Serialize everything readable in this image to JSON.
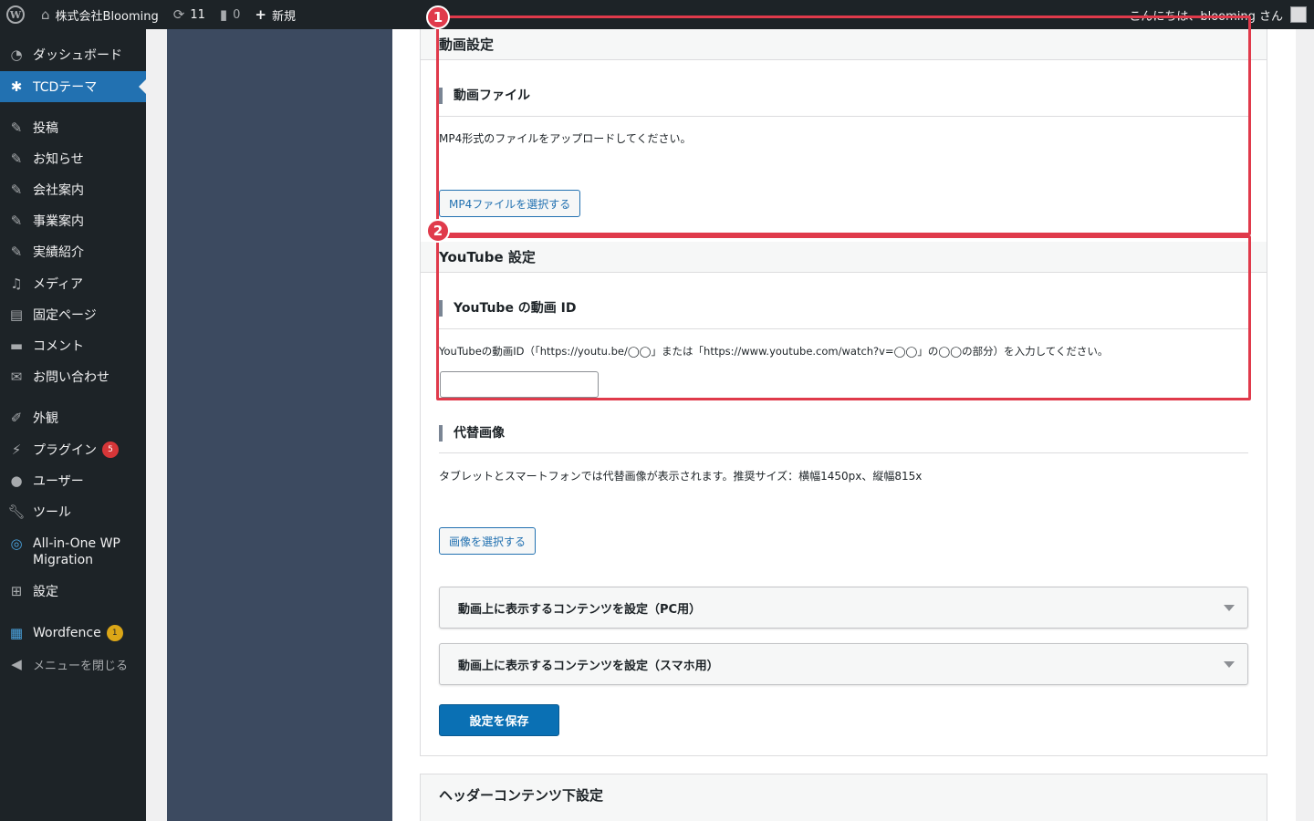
{
  "adminbar": {
    "site_name": "株式会社Blooming",
    "updates_count": "11",
    "comments_count": "0",
    "new_label": "新規",
    "greeting": "こんにちは、blooming さん"
  },
  "sidebar": {
    "items": [
      {
        "label": "ダッシュボード",
        "icon": "dashboard-icon"
      },
      {
        "label": "TCDテーマ",
        "icon": "gear-icon"
      },
      {
        "label": "投稿",
        "icon": "pin-icon"
      },
      {
        "label": "お知らせ",
        "icon": "pin-icon"
      },
      {
        "label": "会社案内",
        "icon": "pin-icon"
      },
      {
        "label": "事業案内",
        "icon": "pin-icon"
      },
      {
        "label": "実績紹介",
        "icon": "pin-icon"
      },
      {
        "label": "メディア",
        "icon": "media-icon"
      },
      {
        "label": "固定ページ",
        "icon": "page-icon"
      },
      {
        "label": "コメント",
        "icon": "comment-icon"
      },
      {
        "label": "お問い合わせ",
        "icon": "mail-icon"
      },
      {
        "label": "外観",
        "icon": "brush-icon"
      },
      {
        "label": "プラグイン",
        "icon": "plugin-icon",
        "badge": "5"
      },
      {
        "label": "ユーザー",
        "icon": "user-icon"
      },
      {
        "label": "ツール",
        "icon": "wrench-icon"
      },
      {
        "label": "All-in-One WP",
        "label2": "Migration",
        "icon": "migration-icon"
      },
      {
        "label": "設定",
        "icon": "settings-icon"
      },
      {
        "label": "Wordfence",
        "icon": "wordfence-icon",
        "badge": "1"
      },
      {
        "label": "メニューを閉じる",
        "icon": "collapse-icon"
      }
    ]
  },
  "video_section": {
    "title": "動画設定",
    "file_heading": "動画ファイル",
    "file_desc": "MP4形式のファイルをアップロードしてください。",
    "file_button": "MP4ファイルを選択する"
  },
  "youtube_section": {
    "title": "YouTube 設定",
    "id_heading": "YouTube の動画 ID",
    "id_desc": "YouTubeの動画ID（「https://youtu.be/◯◯」または「https://www.youtube.com/watch?v=◯◯」の◯◯の部分）を入力してください。",
    "id_value": ""
  },
  "alt_image": {
    "heading": "代替画像",
    "desc": "タブレットとスマートフォンでは代替画像が表示されます。推奨サイズ：横幅1450px、縦幅815x",
    "button": "画像を選択する"
  },
  "accordions": [
    {
      "label": "動画上に表示するコンテンツを設定（PC用）"
    },
    {
      "label": "動画上に表示するコンテンツを設定（スマホ用）"
    }
  ],
  "save_button": "設定を保存",
  "next_section_title": "ヘッダーコンテンツ下設定",
  "annotations": [
    "1",
    "2"
  ],
  "colors": {
    "admin_bg": "#1d2327",
    "active_menu": "#2271b1",
    "theme_panel": "#3c4a60",
    "primary_button": "#0a70b4",
    "annotation": "#e03a4b"
  }
}
